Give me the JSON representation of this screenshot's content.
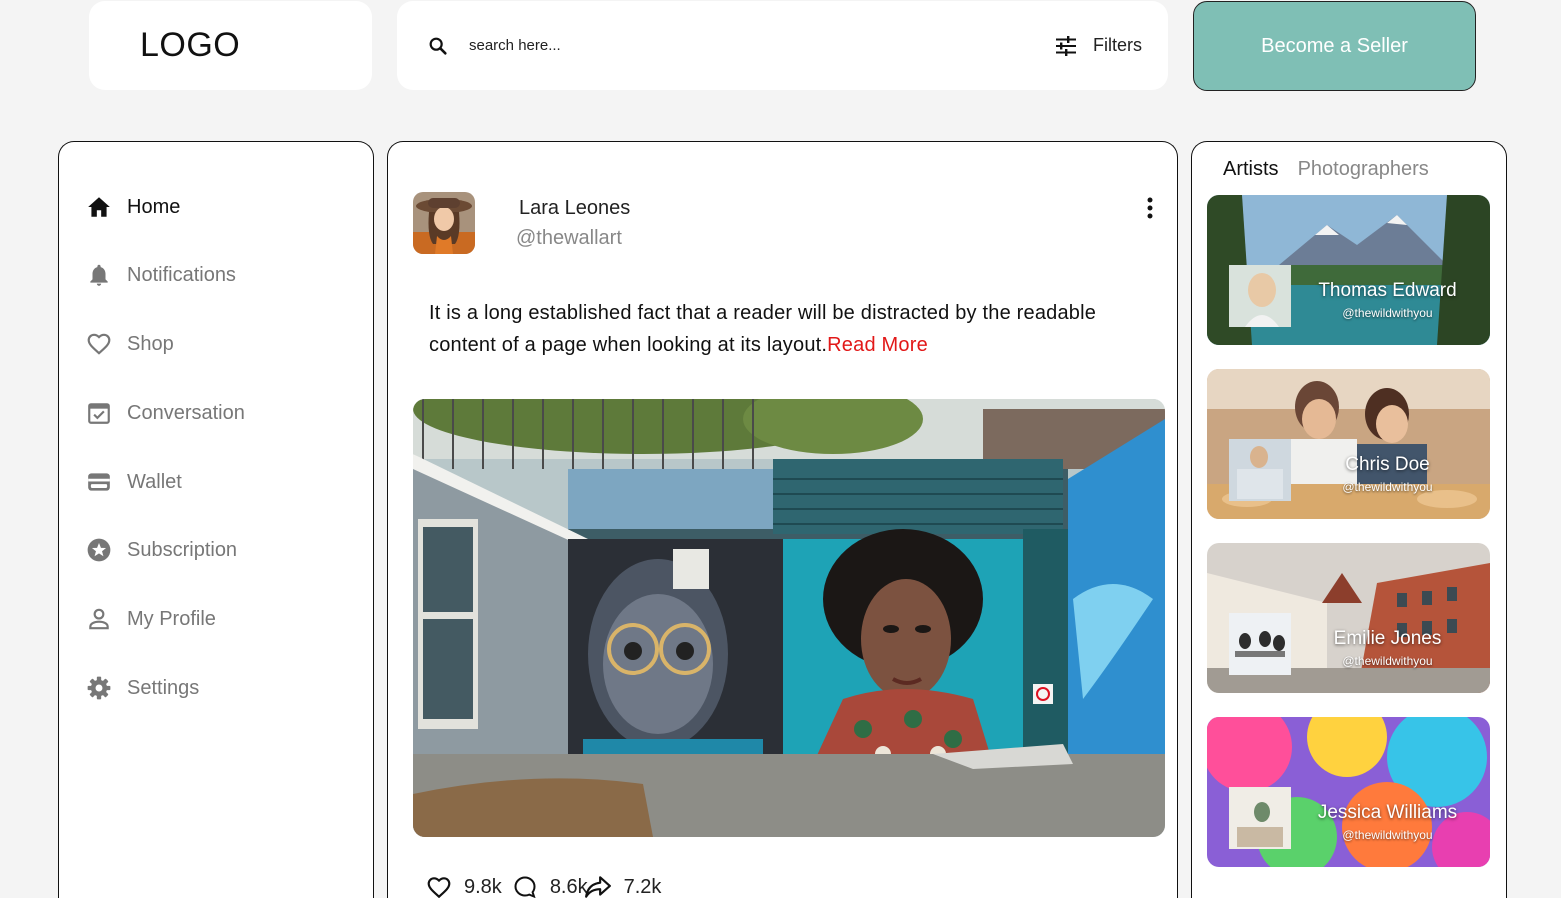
{
  "header": {
    "logo": "LOGO",
    "search_placeholder": "search here...",
    "filters_label": "Filters",
    "seller_button": "Become a Seller"
  },
  "sidebar": {
    "items": [
      {
        "label": "Home",
        "icon": "home-icon",
        "active": true
      },
      {
        "label": "Notifications",
        "icon": "bell-icon"
      },
      {
        "label": "Shop",
        "icon": "heart-icon"
      },
      {
        "label": "Conversation",
        "icon": "checkbox-icon"
      },
      {
        "label": "Wallet",
        "icon": "wallet-icon"
      },
      {
        "label": "Subscription",
        "icon": "star-icon"
      },
      {
        "label": "My Profile",
        "icon": "person-icon"
      },
      {
        "label": "Settings",
        "icon": "gear-icon"
      }
    ]
  },
  "post": {
    "author_name": "Lara Leones",
    "author_handle": "@thewallart",
    "text": "It is a long established fact that a reader will be distracted by the readable content of a page when looking at its layout.",
    "read_more": "Read More",
    "likes": "9.8k",
    "comments": "8.6k",
    "shares": "7.2k"
  },
  "right": {
    "tabs": [
      "Artists",
      "Photographers"
    ],
    "cards": [
      {
        "name": "Thomas Edward",
        "handle": "@thewildwithyou"
      },
      {
        "name": "Chris Doe",
        "handle": "@thewildwithyou"
      },
      {
        "name": "Emilie Jones",
        "handle": "@thewildwithyou"
      },
      {
        "name": "Jessica Williams",
        "handle": "@thewildwithyou"
      }
    ]
  },
  "colors": {
    "accent": "#7fbfb5",
    "read_more": "#e21818",
    "muted_text": "#777777"
  }
}
